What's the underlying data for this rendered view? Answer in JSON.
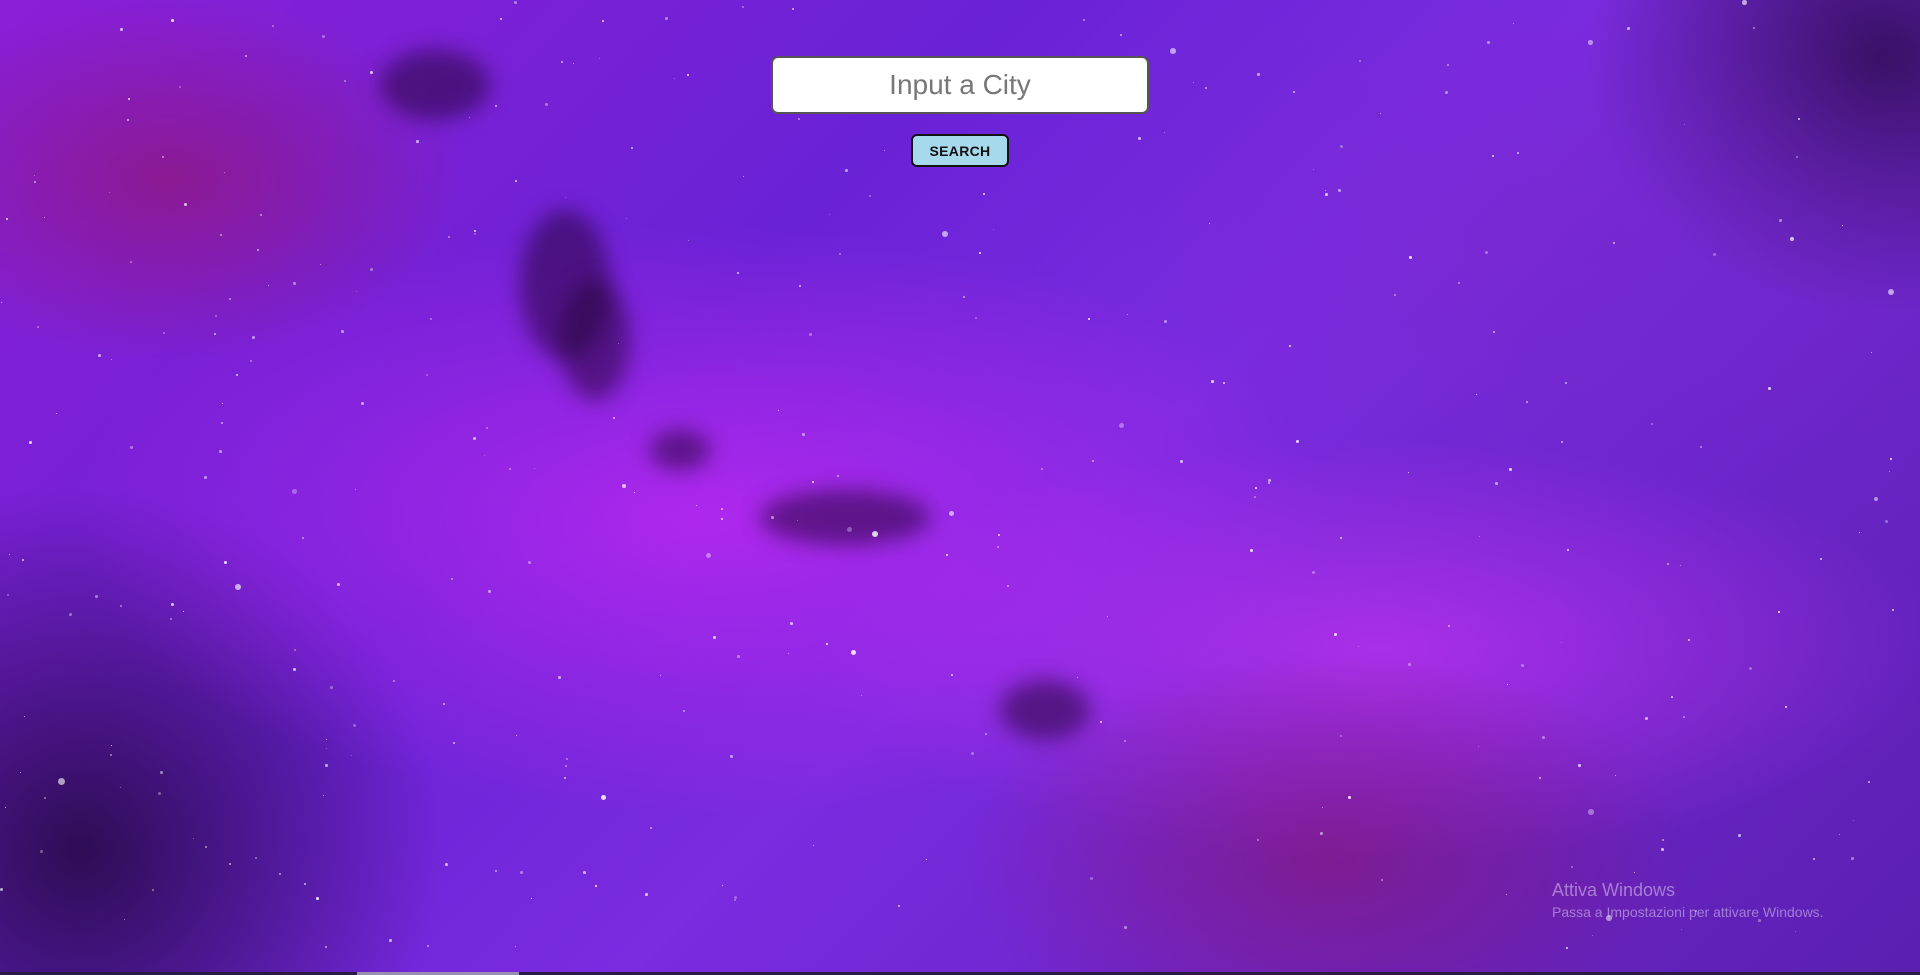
{
  "search": {
    "placeholder": "Input a City",
    "value": "",
    "button_label": "SEARCH"
  },
  "watermark": {
    "title": "Attiva Windows",
    "subtitle": "Passa a Impostazioni per attivare Windows."
  },
  "colors": {
    "button_bg": "#a6d9ec",
    "input_bg": "#ffffff"
  }
}
